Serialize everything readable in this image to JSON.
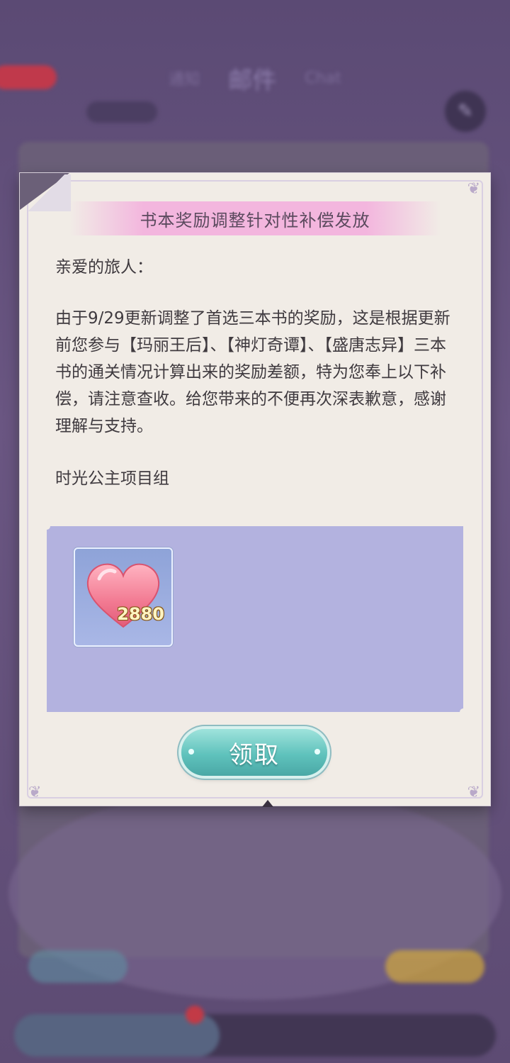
{
  "background": {
    "header_title": "邮件",
    "header_left": "通知",
    "header_right": "Chat"
  },
  "mail": {
    "title": "书本奖励调整针对性补偿发放",
    "greeting": "亲爱的旅人：",
    "body": "由于9/29更新调整了首选三本书的奖励，这是根据更新前您参与【玛丽王后】、【神灯奇谭】、【盛唐志异】三本书的通关情况计算出来的奖励差额，特为您奉上以下补偿，请注意查收。给您带来的不便再次深表歉意，感谢理解与支持。",
    "signature": "时光公主项目组",
    "rewards": [
      {
        "icon": "heart-icon",
        "quantity": "2880"
      }
    ],
    "claim_label": "领取"
  },
  "colors": {
    "card_bg": "#f1ece6",
    "title_bar": "#f3b6de",
    "reward_panel": "#b3b2df",
    "claim_button": "#5fc2bc"
  }
}
